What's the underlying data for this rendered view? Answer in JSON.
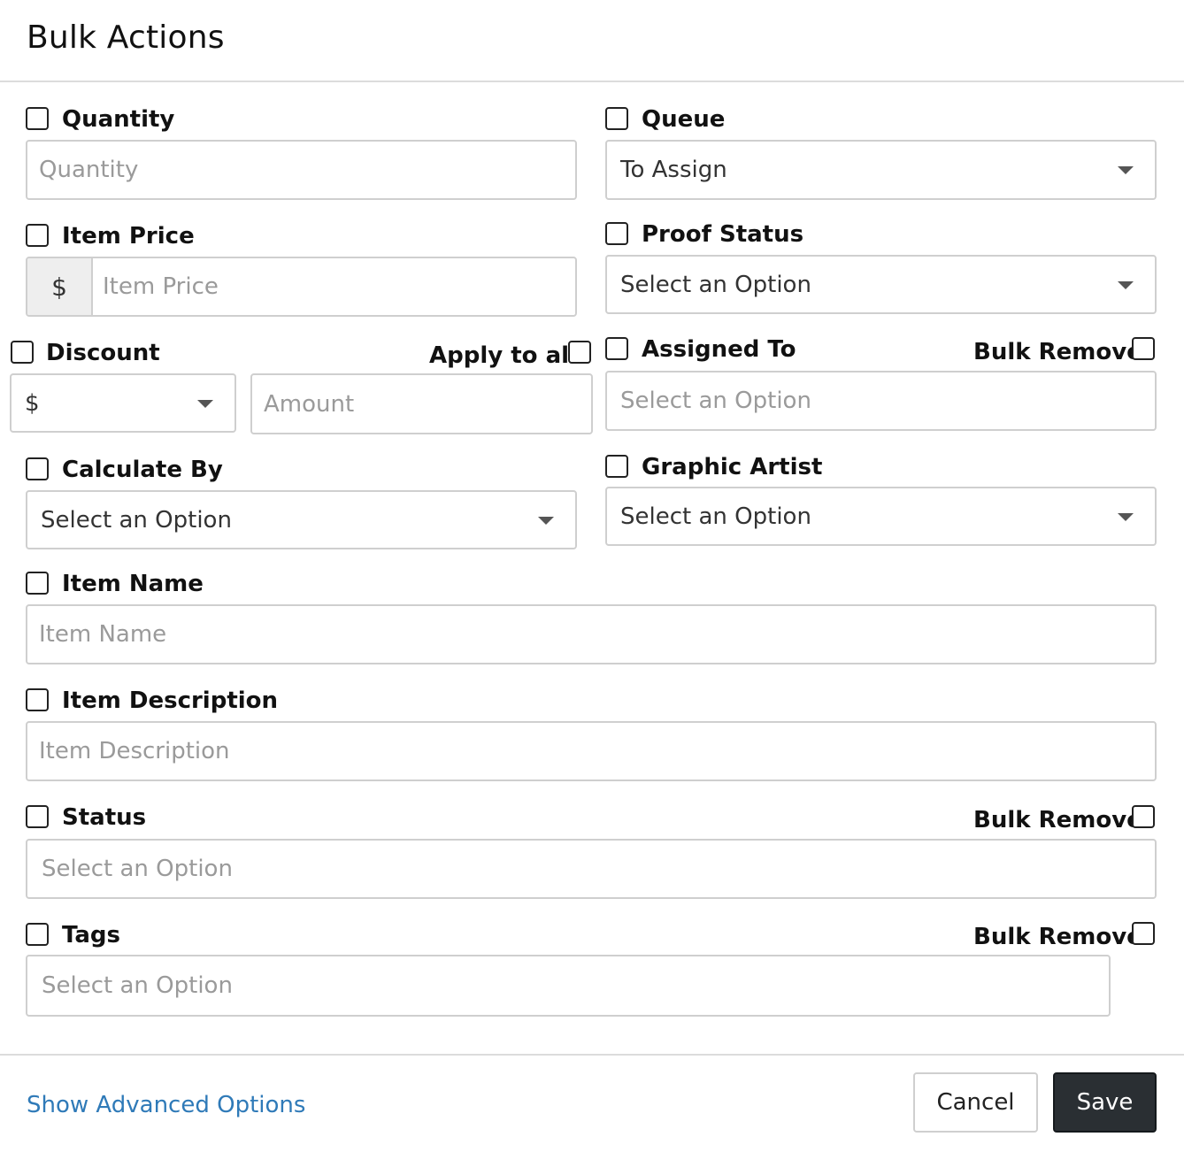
{
  "dialog": {
    "title": "Bulk Actions"
  },
  "fields": {
    "quantity": {
      "label": "Quantity",
      "placeholder": "Quantity"
    },
    "queue": {
      "label": "Queue",
      "value": "To Assign"
    },
    "item_price": {
      "label": "Item Price",
      "prefix": "$",
      "placeholder": "Item Price"
    },
    "proof_status": {
      "label": "Proof Status",
      "value": "Select an Option"
    },
    "discount": {
      "label": "Discount",
      "apply_all_label": "Apply to all",
      "type_value": "$",
      "amount_placeholder": "Amount"
    },
    "assigned_to": {
      "label": "Assigned To",
      "bulk_remove_label": "Bulk Remove",
      "placeholder": "Select an Option"
    },
    "calculate_by": {
      "label": "Calculate By",
      "value": "Select an Option"
    },
    "graphic_artist": {
      "label": "Graphic Artist",
      "value": "Select an Option"
    },
    "item_name": {
      "label": "Item Name",
      "placeholder": "Item Name"
    },
    "item_description": {
      "label": "Item Description",
      "placeholder": "Item Description"
    },
    "status": {
      "label": "Status",
      "bulk_remove_label": "Bulk Remove",
      "placeholder": "Select an Option"
    },
    "tags": {
      "label": "Tags",
      "bulk_remove_label": "Bulk Remove",
      "placeholder": "Select an Option"
    }
  },
  "footer": {
    "advanced_link": "Show Advanced Options",
    "cancel_label": "Cancel",
    "save_label": "Save"
  },
  "colors": {
    "link": "#2f7ab8",
    "save_button": "#2a2f33",
    "border": "#cfcfcf"
  },
  "icons": {
    "dropdown": "caret-down-icon",
    "checkbox": "checkbox-unchecked-icon"
  }
}
